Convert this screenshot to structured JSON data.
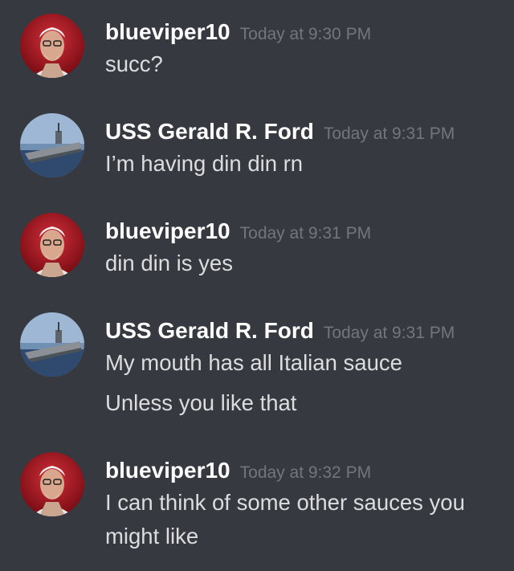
{
  "messages": [
    {
      "author": "blueviper10",
      "time": "Today at 9:30 PM",
      "avatar_icon": "old-man-avatar-icon",
      "lines": [
        "succ?"
      ]
    },
    {
      "author": "USS Gerald R. Ford",
      "time": "Today at 9:31 PM",
      "avatar_icon": "aircraft-carrier-avatar-icon",
      "lines": [
        "I’m having din din rn"
      ]
    },
    {
      "author": "blueviper10",
      "time": "Today at 9:31 PM",
      "avatar_icon": "old-man-avatar-icon",
      "lines": [
        "din din is yes"
      ]
    },
    {
      "author": "USS Gerald R. Ford",
      "time": "Today at 9:31 PM",
      "avatar_icon": "aircraft-carrier-avatar-icon",
      "lines": [
        "My mouth has all Italian sauce",
        "Unless you like that"
      ]
    },
    {
      "author": "blueviper10",
      "time": "Today at 9:32 PM",
      "avatar_icon": "old-man-avatar-icon",
      "lines": [
        "I can think of some other sauces you",
        "might like"
      ]
    }
  ],
  "colors": {
    "background": "#36393f",
    "username": "#ffffff",
    "timestamp": "#72767d",
    "message_text": "#dcddde"
  }
}
